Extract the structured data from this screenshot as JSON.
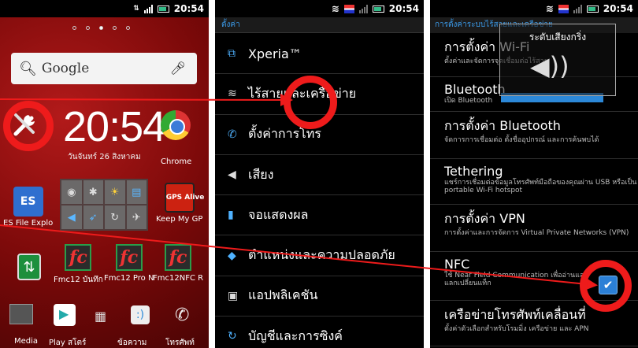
{
  "status": {
    "time": "20:54",
    "battery_color": "#3bb88a"
  },
  "home": {
    "search_label": "Google",
    "clock_time": "20:54",
    "date_label": "วันจันทร์ 26 สิงหาคม",
    "chrome_label": "Chrome",
    "es_label": "ES File Explo",
    "es_icon_text": "ES",
    "gps_label": "Keep My GP",
    "gps_icon_text": "GPS Alive",
    "fmc_icon_text": "fc",
    "fmc_apps": [
      "Fmc12 บันทึก",
      "Fmc12 Pro N",
      "Fmc12NFC R"
    ],
    "dock": {
      "media": "Media",
      "play": "Play สโตร์",
      "messages": "ข้อความ",
      "phone": "โทรศัพท์"
    }
  },
  "settings": {
    "header": "ตั้งค่า",
    "items": [
      {
        "icon": "xperia-icon",
        "label": "Xperia™"
      },
      {
        "icon": "wifi-icon",
        "label": "ไร้สายและเครือข่าย"
      },
      {
        "icon": "phone-call-icon",
        "label": "ตั้งค่าการโทร"
      },
      {
        "icon": "speaker-icon",
        "label": "เสียง"
      },
      {
        "icon": "display-icon",
        "label": "จอแสดงผล"
      },
      {
        "icon": "location-icon",
        "label": "ตำแหน่งและความปลอดภัย"
      },
      {
        "icon": "apps-icon",
        "label": "แอปพลิเคชัน"
      },
      {
        "icon": "sync-icon",
        "label": "บัญชีและการซิงค์"
      }
    ]
  },
  "wireless": {
    "header": "การตั้งค่าระบบไร้สายและเครือข่าย",
    "volume_popup_title": "ระดับเสียงกริ่ง",
    "items": [
      {
        "title": "การตั้งค่า Wi-Fi",
        "subtitle": "ตั้งค่าและจัดการจุดเชื่อมต่อไร้สาย"
      },
      {
        "title": "Bluetooth",
        "subtitle": "เปิด Bluetooth"
      },
      {
        "title": "การตั้งค่า Bluetooth",
        "subtitle": "จัดการการเชื่อมต่อ ตั้งชื่ออุปกรณ์ และการค้นพบได้"
      },
      {
        "title": "Tethering",
        "subtitle": "แชร์การเชื่อมต่อข้อมูลโทรศัพท์มือถือของคุณผ่าน USB หรือเป็น portable Wi-Fi hotspot"
      },
      {
        "title": "การตั้งค่า VPN",
        "subtitle": "การตั้งค่าและการจัดการ Virtual Private Networks (VPN)"
      },
      {
        "title": "NFC",
        "subtitle": "ใช้ Near Field Communication เพื่ออ่านและแลกเปลี่ยนแท็ก"
      },
      {
        "title": "เครือข่ายโทรศัพท์เคลื่อนที่",
        "subtitle": "ตั้งค่าตัวเลือกสำหรับโรมมิ่ง เครือข่าย และ APN"
      }
    ],
    "nfc_checked": true
  },
  "annotation_color": "#ee1b1b"
}
